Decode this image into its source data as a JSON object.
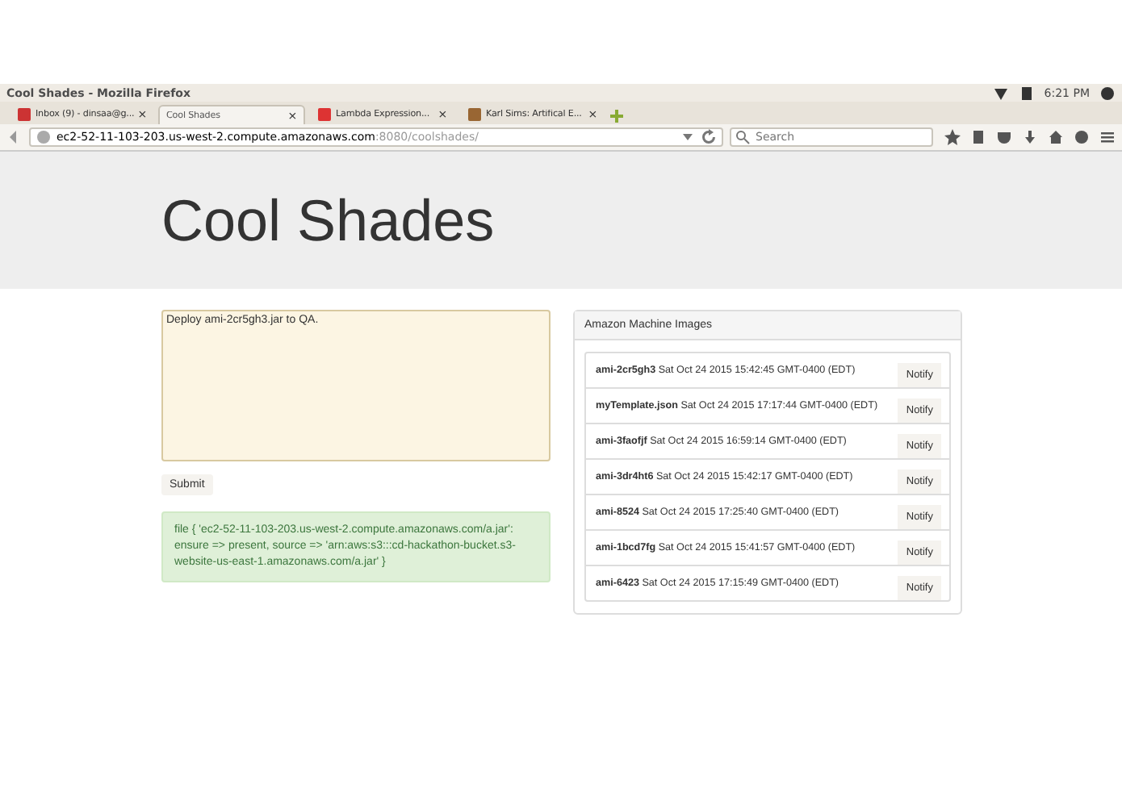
{
  "window": {
    "title": "Cool Shades - Mozilla Firefox"
  },
  "system_tray": {
    "time": "6:21 PM"
  },
  "tabs": [
    {
      "label": "Inbox (9) - dinsaa@g...",
      "selected": false,
      "close": "×"
    },
    {
      "label": "Cool Shades",
      "selected": true,
      "close": "×"
    },
    {
      "label": "Lambda Expression...",
      "selected": false,
      "close": "×"
    },
    {
      "label": "Karl Sims: Artifical E...",
      "selected": false,
      "close": "×"
    }
  ],
  "address_bar": {
    "host": "ec2-52-11-103-203.us-west-2.compute.amazonaws.com",
    "path": ":8080/coolshades/"
  },
  "search": {
    "placeholder": "Search"
  },
  "page": {
    "heading": "Cool Shades",
    "message": {
      "value": "Deploy ami-2cr5gh3.jar to QA."
    },
    "submit": "Submit",
    "result": "file { 'ec2-52-11-103-203.us-west-2.compute.amazonaws.com/a.jar': ensure => present, source => 'arn:aws:s3:::cd-hackathon-bucket.s3-website-us-east-1.amazonaws.com/a.jar' }",
    "panel": {
      "title": "Amazon Machine Images",
      "items": [
        {
          "name": "ami-2cr5gh3",
          "date": "Sat Oct 24 2015 15:42:45 GMT-0400 (EDT)",
          "action": "Notify"
        },
        {
          "name": "myTemplate.json",
          "date": "Sat Oct 24 2015 17:17:44 GMT-0400 (EDT)",
          "action": "Notify"
        },
        {
          "name": "ami-3faofjf",
          "date": "Sat Oct 24 2015 16:59:14 GMT-0400 (EDT)",
          "action": "Notify"
        },
        {
          "name": "ami-3dr4ht6",
          "date": "Sat Oct 24 2015 15:42:17 GMT-0400 (EDT)",
          "action": "Notify"
        },
        {
          "name": "ami-8524",
          "date": "Sat Oct 24 2015 17:25:40 GMT-0400 (EDT)",
          "action": "Notify"
        },
        {
          "name": "ami-1bcd7fg",
          "date": "Sat Oct 24 2015 15:41:57 GMT-0400 (EDT)",
          "action": "Notify"
        },
        {
          "name": "ami-6423",
          "date": "Sat Oct 24 2015 17:15:49 GMT-0400 (EDT)",
          "action": "Notify"
        }
      ]
    }
  }
}
